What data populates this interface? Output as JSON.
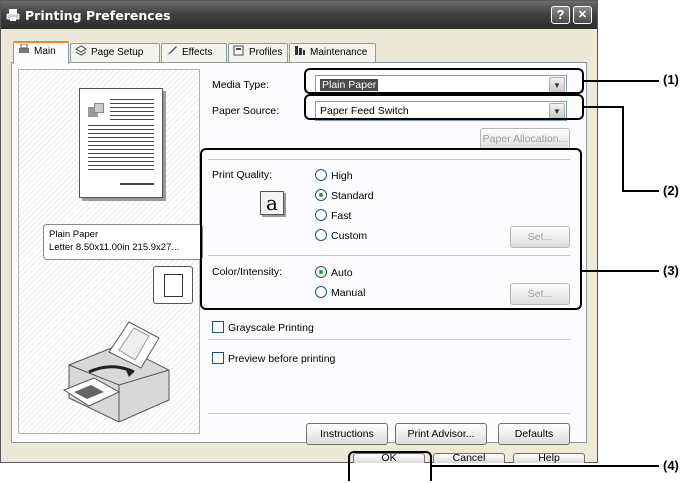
{
  "window": {
    "title": "Printing Preferences",
    "help_btn": "?",
    "close_btn": "✕"
  },
  "tabs": [
    {
      "label": "Main",
      "icon": "printer-icon"
    },
    {
      "label": "Page Setup",
      "icon": "page-setup-icon"
    },
    {
      "label": "Effects",
      "icon": "effects-brush-icon"
    },
    {
      "label": "Profiles",
      "icon": "profiles-icon"
    },
    {
      "label": "Maintenance",
      "icon": "maintenance-icon"
    }
  ],
  "preview": {
    "media_line": "Plain Paper",
    "size_line": "Letter 8.50x11.00in 215.9x27..."
  },
  "fields": {
    "media_type_label": "Media Type:",
    "media_type_value": "Plain Paper",
    "paper_source_label": "Paper Source:",
    "paper_source_value": "Paper Feed Switch",
    "paper_allocation_btn": "Paper Allocation..."
  },
  "print_quality": {
    "label": "Print Quality:",
    "options": [
      {
        "label": "High",
        "selected": false
      },
      {
        "label": "Standard",
        "selected": true
      },
      {
        "label": "Fast",
        "selected": false
      },
      {
        "label": "Custom",
        "selected": false
      }
    ],
    "set_btn": "Set...",
    "quality_icon_char": "a"
  },
  "color_intensity": {
    "label": "Color/Intensity:",
    "options": [
      {
        "label": "Auto",
        "selected": true
      },
      {
        "label": "Manual",
        "selected": false
      }
    ],
    "set_btn": "Set..."
  },
  "checkboxes": {
    "grayscale": "Grayscale Printing",
    "preview": "Preview before printing"
  },
  "bottom_buttons": {
    "instructions": "Instructions",
    "print_advisor": "Print Advisor...",
    "defaults": "Defaults"
  },
  "dialog_buttons": {
    "ok": "OK",
    "cancel": "Cancel",
    "help": "Help"
  },
  "callouts": {
    "c1": "(1)",
    "c2": "(2)",
    "c3": "(3)",
    "c4": "(4)"
  },
  "colors": {
    "title_bar": "#3e3e3e",
    "dialog_bg": "#ece9d8",
    "active_tab_accent": "#e68b2c"
  }
}
